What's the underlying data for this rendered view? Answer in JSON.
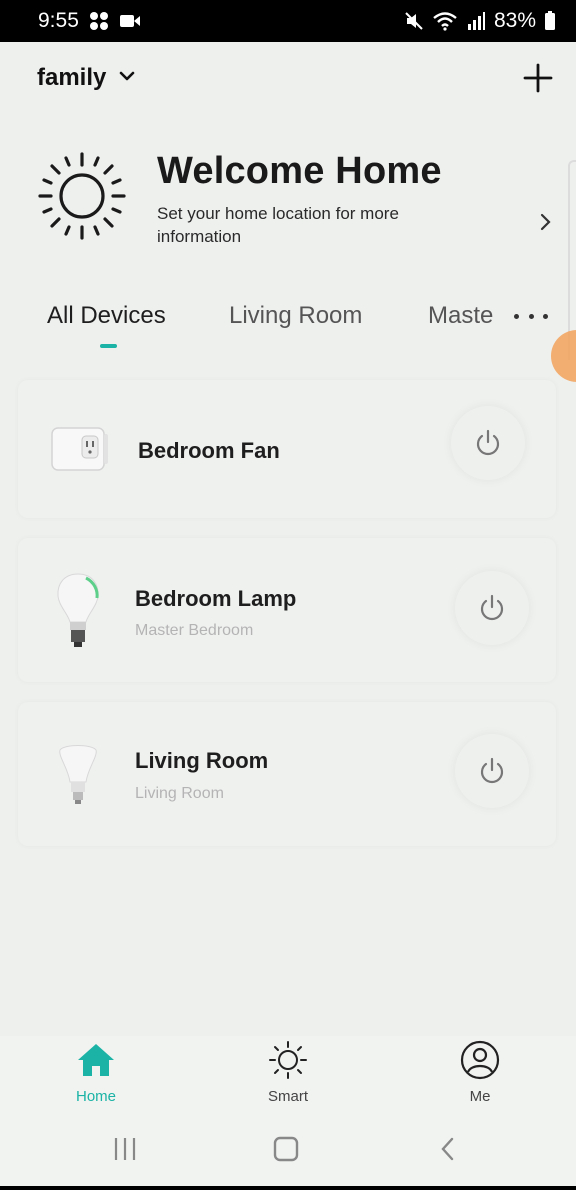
{
  "status_bar": {
    "time": "9:55",
    "battery": "83%",
    "icons": [
      "grid-icon",
      "video-icon",
      "mute-icon",
      "wifi-icon",
      "signal-icon",
      "battery-icon"
    ]
  },
  "header": {
    "home_name": "family",
    "dropdown_icon": "chevron-down-icon",
    "add_icon": "plus-icon"
  },
  "welcome": {
    "title": "Welcome Home",
    "subtitle": "Set your home location for more information",
    "icon": "sun-icon"
  },
  "tabs": [
    {
      "label": "All Devices",
      "active": true
    },
    {
      "label": "Living Room",
      "active": false
    },
    {
      "label": "Maste",
      "active": false
    }
  ],
  "devices": [
    {
      "name": "Bedroom Fan",
      "room": "",
      "icon": "smart-plug-icon"
    },
    {
      "name": "Bedroom Lamp",
      "room": "Master Bedroom",
      "icon": "light-bulb-icon"
    },
    {
      "name": "Living Room",
      "room": "Living Room",
      "icon": "light-bulb-icon"
    }
  ],
  "bottom_nav": [
    {
      "label": "Home",
      "icon": "home-icon",
      "active": true
    },
    {
      "label": "Smart",
      "icon": "sun-icon",
      "active": false
    },
    {
      "label": "Me",
      "icon": "user-icon",
      "active": false
    }
  ],
  "colors": {
    "accent": "#1bb3a5",
    "background": "#eef0ee",
    "status_bar": "#000000"
  }
}
